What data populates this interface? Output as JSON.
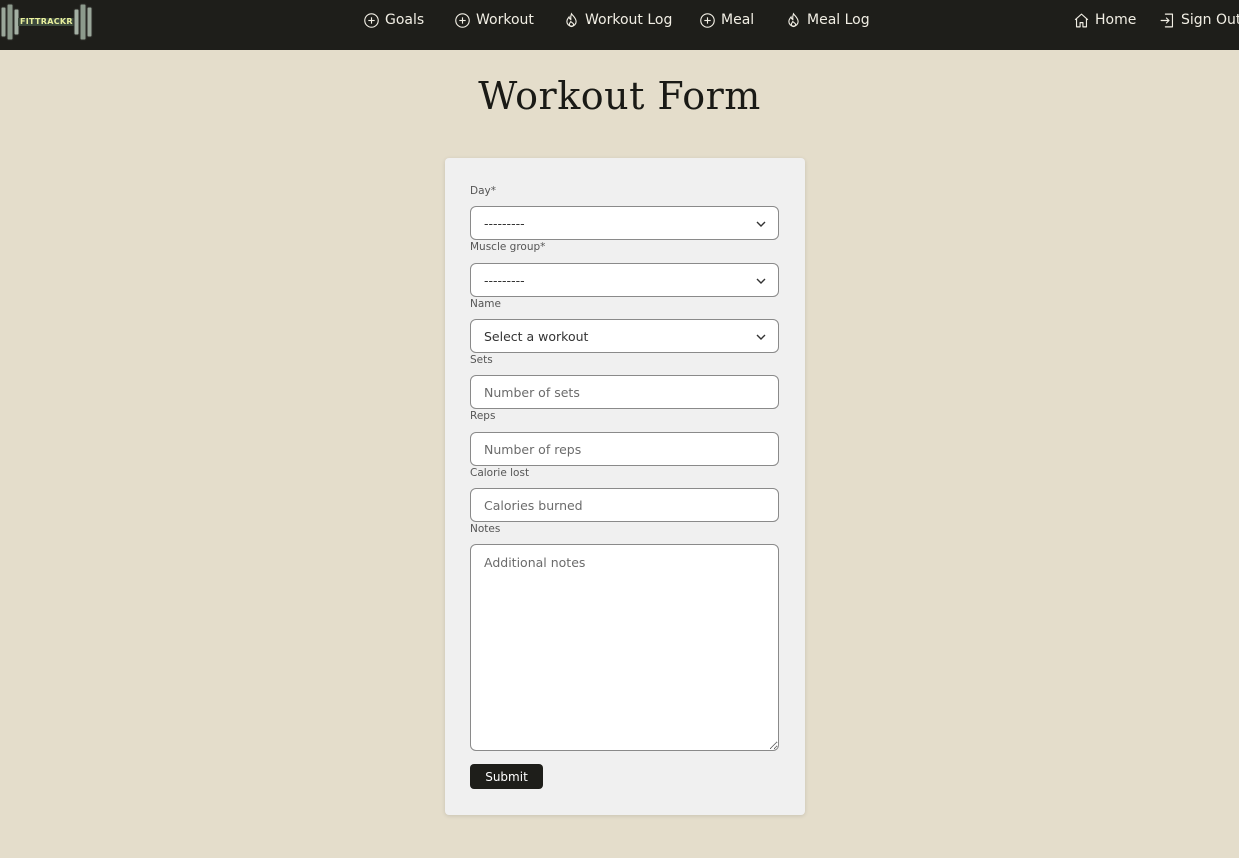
{
  "app": {
    "logo_text": "FITTRACKR"
  },
  "nav": {
    "items": [
      {
        "label": "Goals",
        "icon": "plus-circle-icon"
      },
      {
        "label": "Workout",
        "icon": "plus-circle-icon"
      },
      {
        "label": "Workout Log",
        "icon": "flame-icon"
      },
      {
        "label": "Meal",
        "icon": "plus-circle-icon"
      },
      {
        "label": "Meal Log",
        "icon": "flame-icon"
      }
    ],
    "right": [
      {
        "label": "Home",
        "icon": "home-icon"
      },
      {
        "label": "Sign Out",
        "icon": "sign-out-icon"
      }
    ]
  },
  "page": {
    "title": "Workout Form"
  },
  "form": {
    "day": {
      "label": "Day*",
      "value": "---------"
    },
    "muscle_group": {
      "label": "Muscle group*",
      "value": "---------"
    },
    "name": {
      "label": "Name",
      "value": "Select a workout"
    },
    "sets": {
      "label": "Sets",
      "placeholder": "Number of sets"
    },
    "reps": {
      "label": "Reps",
      "placeholder": "Number of reps"
    },
    "calorie_lost": {
      "label": "Calorie lost",
      "placeholder": "Calories burned"
    },
    "notes": {
      "label": "Notes",
      "placeholder": "Additional notes"
    },
    "submit_label": "Submit"
  },
  "colors": {
    "background": "#e4ddcb",
    "navbar": "#1e1e1a",
    "card": "#f0f0f0",
    "logo_accent": "#e8ef9c",
    "button": "#1e1e1a"
  }
}
